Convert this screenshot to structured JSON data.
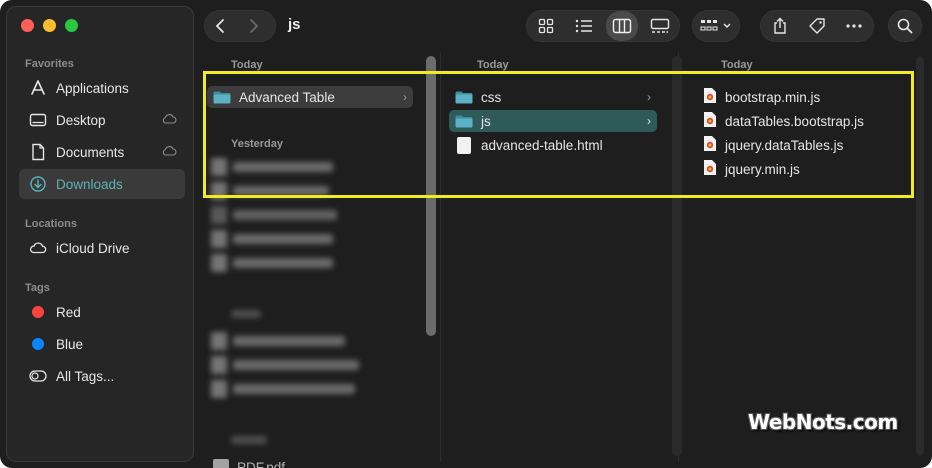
{
  "window": {
    "title": "js"
  },
  "colors": {
    "accent": "#5fb3b3",
    "selection_teal": "#2e5a5a",
    "highlight": "#f2ec1e",
    "close": "#ff5f57",
    "minimize": "#febc2e",
    "zoom": "#28c840",
    "tag_red": "#ff453a",
    "tag_blue": "#0a84ff"
  },
  "sidebar": {
    "favorites_label": "Favorites",
    "favorites": [
      {
        "label": "Applications",
        "icon": "applications-icon"
      },
      {
        "label": "Desktop",
        "icon": "desktop-icon"
      },
      {
        "label": "Documents",
        "icon": "documents-icon"
      },
      {
        "label": "Downloads",
        "icon": "downloads-icon",
        "active": true
      }
    ],
    "locations_label": "Locations",
    "locations": [
      {
        "label": "iCloud Drive",
        "icon": "cloud-icon"
      }
    ],
    "tags_label": "Tags",
    "tags": [
      {
        "label": "Red",
        "color": "#ff453a"
      },
      {
        "label": "Blue",
        "color": "#0a84ff"
      },
      {
        "label": "All Tags...",
        "icon": "all-tags-icon"
      }
    ]
  },
  "toolbar": {
    "back": "chevron-left-icon",
    "forward": "chevron-right-icon",
    "views": [
      "icon-view-icon",
      "list-view-icon",
      "column-view-icon",
      "gallery-view-icon"
    ],
    "selected_view": "column-view-icon"
  },
  "columns": [
    {
      "sections": [
        {
          "header": "Today",
          "items": [
            {
              "name": "Advanced Table",
              "kind": "folder",
              "selected": "gray"
            }
          ]
        },
        {
          "header": "Yesterday",
          "items": []
        }
      ],
      "bottom_item": "PDF.pdf"
    },
    {
      "sections": [
        {
          "header": "Today",
          "items": [
            {
              "name": "css",
              "kind": "folder"
            },
            {
              "name": "js",
              "kind": "folder",
              "selected": "teal"
            },
            {
              "name": "advanced-table.html",
              "kind": "file"
            }
          ]
        }
      ]
    },
    {
      "sections": [
        {
          "header": "Today",
          "items": [
            {
              "name": "bootstrap.min.js",
              "kind": "js"
            },
            {
              "name": "dataTables.bootstrap.js",
              "kind": "js"
            },
            {
              "name": "jquery.dataTables.js",
              "kind": "js"
            },
            {
              "name": "jquery.min.js",
              "kind": "js"
            }
          ]
        }
      ]
    }
  ],
  "watermark": "WebNots.com"
}
